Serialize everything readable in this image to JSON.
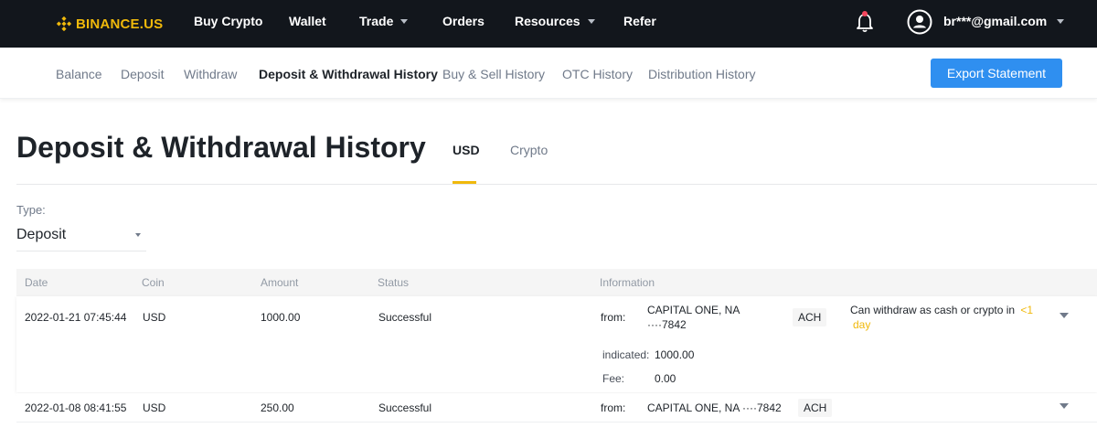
{
  "brand": {
    "logo_text": "BINANCE.US",
    "accent_color": "#f0b90b"
  },
  "topnav": {
    "items": [
      {
        "label": "Buy Crypto",
        "dropdown": false
      },
      {
        "label": "Wallet",
        "dropdown": false
      },
      {
        "label": "Trade",
        "dropdown": true
      },
      {
        "label": "Orders",
        "dropdown": false
      },
      {
        "label": "Resources",
        "dropdown": true
      },
      {
        "label": "Refer",
        "dropdown": false
      }
    ],
    "user_email": "br***@gmail.com"
  },
  "subnav": {
    "items": [
      {
        "label": "Balance"
      },
      {
        "label": "Deposit"
      },
      {
        "label": "Withdraw"
      },
      {
        "label": "Deposit & Withdrawal History",
        "active": true
      },
      {
        "label": "Buy & Sell History"
      },
      {
        "label": "OTC History"
      },
      {
        "label": "Distribution History"
      }
    ],
    "export_label": "Export Statement"
  },
  "page": {
    "title": "Deposit & Withdrawal History",
    "tabs": [
      {
        "label": "USD",
        "active": true
      },
      {
        "label": "Crypto",
        "active": false
      }
    ]
  },
  "filter": {
    "type_label": "Type:",
    "type_value": "Deposit"
  },
  "table": {
    "columns": [
      "Date",
      "Coin",
      "Amount",
      "Status",
      "Information"
    ],
    "rows": [
      {
        "date": "2022-01-21 07:45:44",
        "coin": "USD",
        "amount": "1000.00",
        "status": "Successful",
        "from_label": "from:",
        "bank_line1": "CAPITAL ONE, NA",
        "bank_line2": "····7842",
        "method": "ACH",
        "note_prefix": "Can withdraw as cash or crypto in",
        "note_highlight_1": "<1",
        "note_highlight_2": "day",
        "indicated_label": "indicated:",
        "indicated_value": "1000.00",
        "fee_label": "Fee:",
        "fee_value": "0.00"
      },
      {
        "date": "2022-01-08 08:41:55",
        "coin": "USD",
        "amount": "250.00",
        "status": "Successful",
        "from_label": "from:",
        "bank": "CAPITAL ONE, NA ····7842",
        "method": "ACH"
      }
    ]
  }
}
